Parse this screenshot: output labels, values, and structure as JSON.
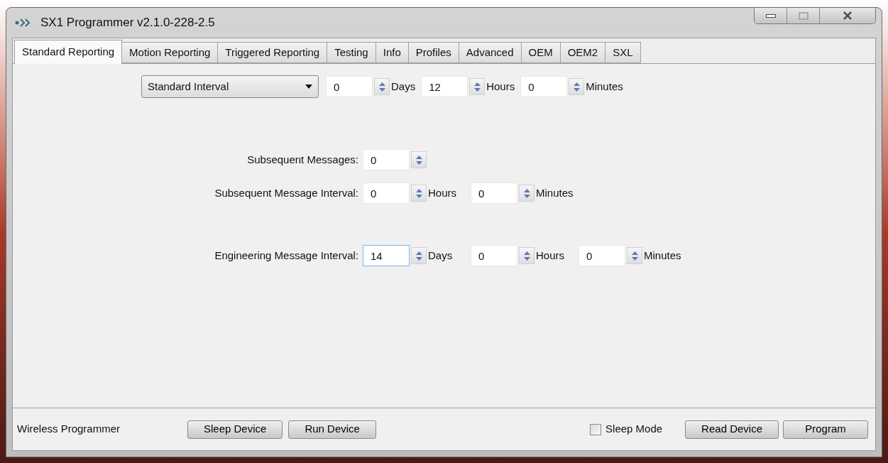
{
  "window": {
    "title": "SX1 Programmer v2.1.0-228-2.5"
  },
  "tabs": [
    {
      "label": "Standard Reporting",
      "selected": true
    },
    {
      "label": "Motion Reporting",
      "selected": false
    },
    {
      "label": "Triggered Reporting",
      "selected": false
    },
    {
      "label": "Testing",
      "selected": false
    },
    {
      "label": "Info",
      "selected": false
    },
    {
      "label": "Profiles",
      "selected": false
    },
    {
      "label": "Advanced",
      "selected": false
    },
    {
      "label": "OEM",
      "selected": false
    },
    {
      "label": "OEM2",
      "selected": false
    },
    {
      "label": "SXL",
      "selected": false
    }
  ],
  "interval_row": {
    "dropdown": {
      "value": "Standard Interval"
    },
    "spinners": [
      {
        "value": "0",
        "unit": "Days",
        "focused": false
      },
      {
        "value": "12",
        "unit": "Hours",
        "focused": false
      },
      {
        "value": "0",
        "unit": "Minutes",
        "focused": false
      }
    ]
  },
  "fields": [
    {
      "label": "Subsequent Messages:",
      "spinners": [
        {
          "value": "0",
          "focused": false
        }
      ]
    },
    {
      "label": "Subsequent Message Interval:",
      "spinners": [
        {
          "value": "0",
          "unit": "Hours",
          "focused": false
        },
        {
          "value": "0",
          "unit": "Minutes",
          "focused": false
        }
      ]
    },
    {
      "label": "Engineering Message Interval:",
      "spinners": [
        {
          "value": "14",
          "unit": "Days",
          "focused": true
        },
        {
          "value": "0",
          "unit": "Hours",
          "focused": false
        },
        {
          "value": "0",
          "unit": "Minutes",
          "focused": false
        }
      ]
    }
  ],
  "footer": {
    "status": "Wireless Programmer",
    "left_buttons": [
      "Sleep Device",
      "Run Device"
    ],
    "checkbox": {
      "label": "Sleep Mode",
      "checked": false
    },
    "right_buttons": [
      "Read Device",
      "Program"
    ]
  }
}
